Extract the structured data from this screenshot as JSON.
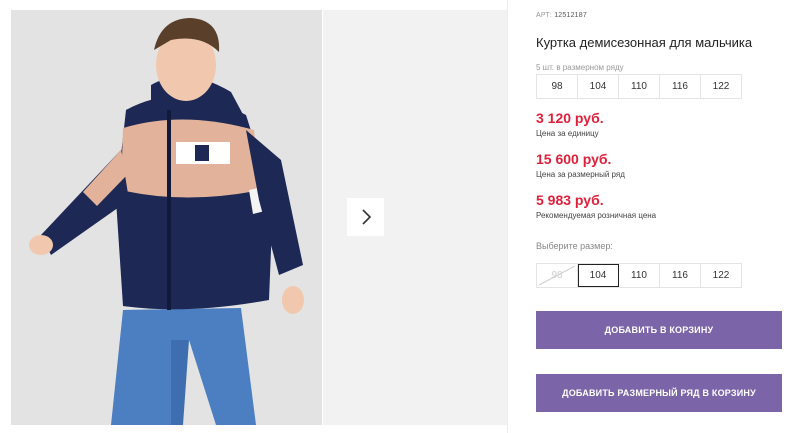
{
  "product": {
    "article_label": "АРТ:",
    "article_number": "12512187",
    "title": "Куртка демисезонная для мальчика",
    "row_label": "5 шт. в размерном ряду",
    "row_sizes": [
      "98",
      "104",
      "110",
      "116",
      "122"
    ]
  },
  "prices": [
    {
      "value": "3 120 руб.",
      "note": "Цена за единицу"
    },
    {
      "value": "15 600 руб.",
      "note": "Цена за размерный ряд"
    },
    {
      "value": "5 983 руб.",
      "note": "Рекомендуемая розничная цена"
    }
  ],
  "size_selector": {
    "label": "Выберите размер:",
    "options": [
      "98",
      "104",
      "110",
      "116",
      "122"
    ],
    "selected": "104",
    "disabled": [
      "98"
    ]
  },
  "buttons": {
    "add_to_cart": "Добавить в корзину",
    "add_row_to_cart": "Добавить размерный ряд в корзину"
  },
  "gallery": {
    "next_icon": "chevron-right-icon"
  },
  "colors": {
    "price": "#e0203a",
    "button": "#7b64a8"
  }
}
